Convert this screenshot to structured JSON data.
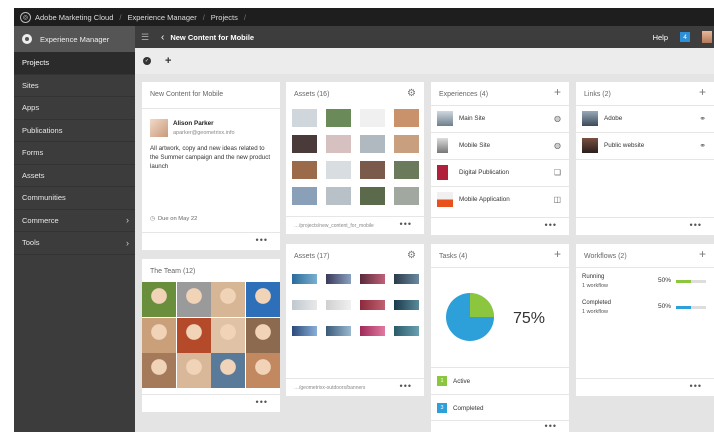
{
  "topbar": {
    "brand": "Adobe Marketing Cloud",
    "crumbs": [
      "Experience Manager",
      "Projects"
    ]
  },
  "sidebar": {
    "header": "Experience Manager",
    "items": [
      {
        "label": "Projects",
        "active": true
      },
      {
        "label": "Sites"
      },
      {
        "label": "Apps"
      },
      {
        "label": "Publications"
      },
      {
        "label": "Forms"
      },
      {
        "label": "Assets"
      },
      {
        "label": "Communities"
      },
      {
        "label": "Commerce",
        "chevron": true
      },
      {
        "label": "Tools",
        "chevron": true
      }
    ]
  },
  "header": {
    "title": "New Content for Mobile",
    "help": "Help",
    "notifications": "4"
  },
  "cards": {
    "project": {
      "title": "New Content for Mobile",
      "owner_name": "Alison Parker",
      "owner_email": "aparker@geometrixx.info",
      "description": "All artwork, copy and new ideas related to the Summer campaign and the new product launch",
      "due": "Due on May 22"
    },
    "team": {
      "title": "The Team (12)"
    },
    "assets1": {
      "title": "Assets (16)",
      "path": "…/projects/new_content_for_mobile"
    },
    "assets2": {
      "title": "Assets (17)",
      "path": "…/geometrixx-outdoors/banners"
    },
    "experiences": {
      "title": "Experiences (4)",
      "items": [
        {
          "label": "Main Site",
          "icon": "globe-icon"
        },
        {
          "label": "Mobile Site",
          "icon": "globe-icon"
        },
        {
          "label": "Digital Publication",
          "icon": "publication-icon"
        },
        {
          "label": "Mobile Application",
          "icon": "mobile-app-icon"
        }
      ]
    },
    "tasks": {
      "title": "Tasks (4)",
      "percent": "75%",
      "fraction": 0.75,
      "statuses": [
        {
          "count": "1",
          "label": "Active",
          "color": "#8cc63f"
        },
        {
          "count": "3",
          "label": "Completed",
          "color": "#2d9fd9"
        }
      ]
    },
    "links": {
      "title": "Links (2)",
      "items": [
        {
          "label": "Adobe",
          "icon": "link-icon"
        },
        {
          "label": "Public website",
          "icon": "link-icon"
        }
      ]
    },
    "workflows": {
      "title": "Workflows (2)",
      "items": [
        {
          "status": "Running",
          "count": "1 workflow",
          "percent": "50%",
          "progress": 0.5,
          "color": "#8cc63f"
        },
        {
          "status": "Completed",
          "count": "1 workflow",
          "percent": "50%",
          "progress": 0.5,
          "color": "#2d9fd9"
        }
      ]
    }
  }
}
